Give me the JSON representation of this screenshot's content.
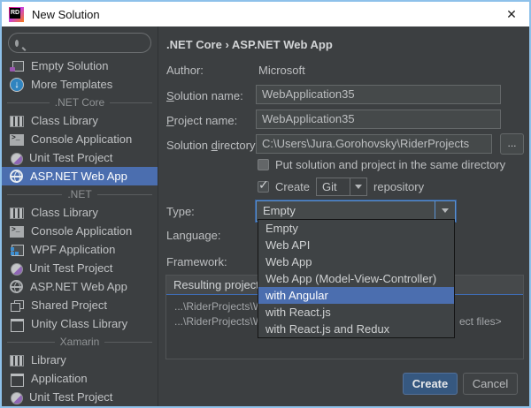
{
  "window": {
    "title": "New Solution",
    "close_glyph": "✕"
  },
  "sidebar": {
    "search_placeholder": "",
    "items": [
      {
        "type": "item",
        "icon": "solution-icon",
        "label": "Empty Solution",
        "selected": false
      },
      {
        "type": "item",
        "icon": "more-templates-icon",
        "label": "More Templates",
        "selected": false
      },
      {
        "type": "section",
        "label": ".NET Core"
      },
      {
        "type": "item",
        "icon": "class-library-icon",
        "label": "Class Library",
        "selected": false
      },
      {
        "type": "item",
        "icon": "console-icon",
        "label": "Console Application",
        "selected": false
      },
      {
        "type": "item",
        "icon": "unit-test-icon",
        "label": "Unit Test Project",
        "selected": false
      },
      {
        "type": "item",
        "icon": "web-app-icon",
        "label": "ASP.NET Web App",
        "selected": true
      },
      {
        "type": "section",
        "label": ".NET"
      },
      {
        "type": "item",
        "icon": "class-library-icon",
        "label": "Class Library",
        "selected": false
      },
      {
        "type": "item",
        "icon": "console-icon",
        "label": "Console Application",
        "selected": false
      },
      {
        "type": "item",
        "icon": "wpf-icon",
        "label": "WPF Application",
        "selected": false
      },
      {
        "type": "item",
        "icon": "unit-test-icon",
        "label": "Unit Test Project",
        "selected": false
      },
      {
        "type": "item",
        "icon": "web-app-icon",
        "label": "ASP.NET Web App",
        "selected": false
      },
      {
        "type": "item",
        "icon": "shared-project-icon",
        "label": "Shared Project",
        "selected": false
      },
      {
        "type": "item",
        "icon": "unity-icon",
        "label": "Unity Class Library",
        "selected": false
      },
      {
        "type": "section",
        "label": "Xamarin"
      },
      {
        "type": "item",
        "icon": "class-library-icon",
        "label": "Library",
        "selected": false
      },
      {
        "type": "item",
        "icon": "application-icon",
        "label": "Application",
        "selected": false
      },
      {
        "type": "item",
        "icon": "unit-test-icon",
        "label": "Unit Test Project",
        "selected": false
      }
    ]
  },
  "panel": {
    "breadcrumb": ".NET Core › ASP.NET Web App",
    "author": {
      "label": "Author:",
      "value": "Microsoft"
    },
    "solution_name": {
      "label_u": "S",
      "label_rest": "olution name:",
      "value": "WebApplication35"
    },
    "project_name": {
      "label_u": "P",
      "label_rest": "roject name:",
      "value": "WebApplication35"
    },
    "solution_directory": {
      "label_pre": "Solution ",
      "label_u": "d",
      "label_rest": "irectory:",
      "value": "C:\\Users\\Jura.Gorohovsky\\RiderProjects",
      "browse": "..."
    },
    "same_dir_checkbox": {
      "label": "Put solution and project in the same directory",
      "checked": false
    },
    "vcs_checkbox": {
      "label_before": "Create",
      "vcs_value": "Git",
      "label_after": "repository",
      "checked": true
    },
    "type_field": {
      "label": "Type:",
      "value": "Empty"
    },
    "language_field": {
      "label": "Language:"
    },
    "framework_field": {
      "label": "Framework:"
    },
    "results_box": {
      "title_fragment": "Resulting project s",
      "line1_fragment": "...\\RiderProjects\\W",
      "line2_fragment": "...\\RiderProjects\\W",
      "line2_right_fragment": "ect files>"
    },
    "buttons": {
      "create": "Create",
      "cancel": "Cancel"
    }
  },
  "type_dropdown": {
    "options": [
      "Empty",
      "Web API",
      "Web App",
      "Web App (Model-View-Controller)",
      "with Angular",
      "with React.js",
      "with React.js and Redux"
    ],
    "highlighted": "with Angular",
    "highlighted_index": 4
  },
  "colors": {
    "selection_blue": "#4b6eaf",
    "focus_border_blue": "#5a92d2",
    "create_button_blue": "#365880",
    "window_border_blue": "#8ec1ea",
    "panel_bg": "#3c3f41",
    "titlebar_bg": "#ffffff"
  }
}
